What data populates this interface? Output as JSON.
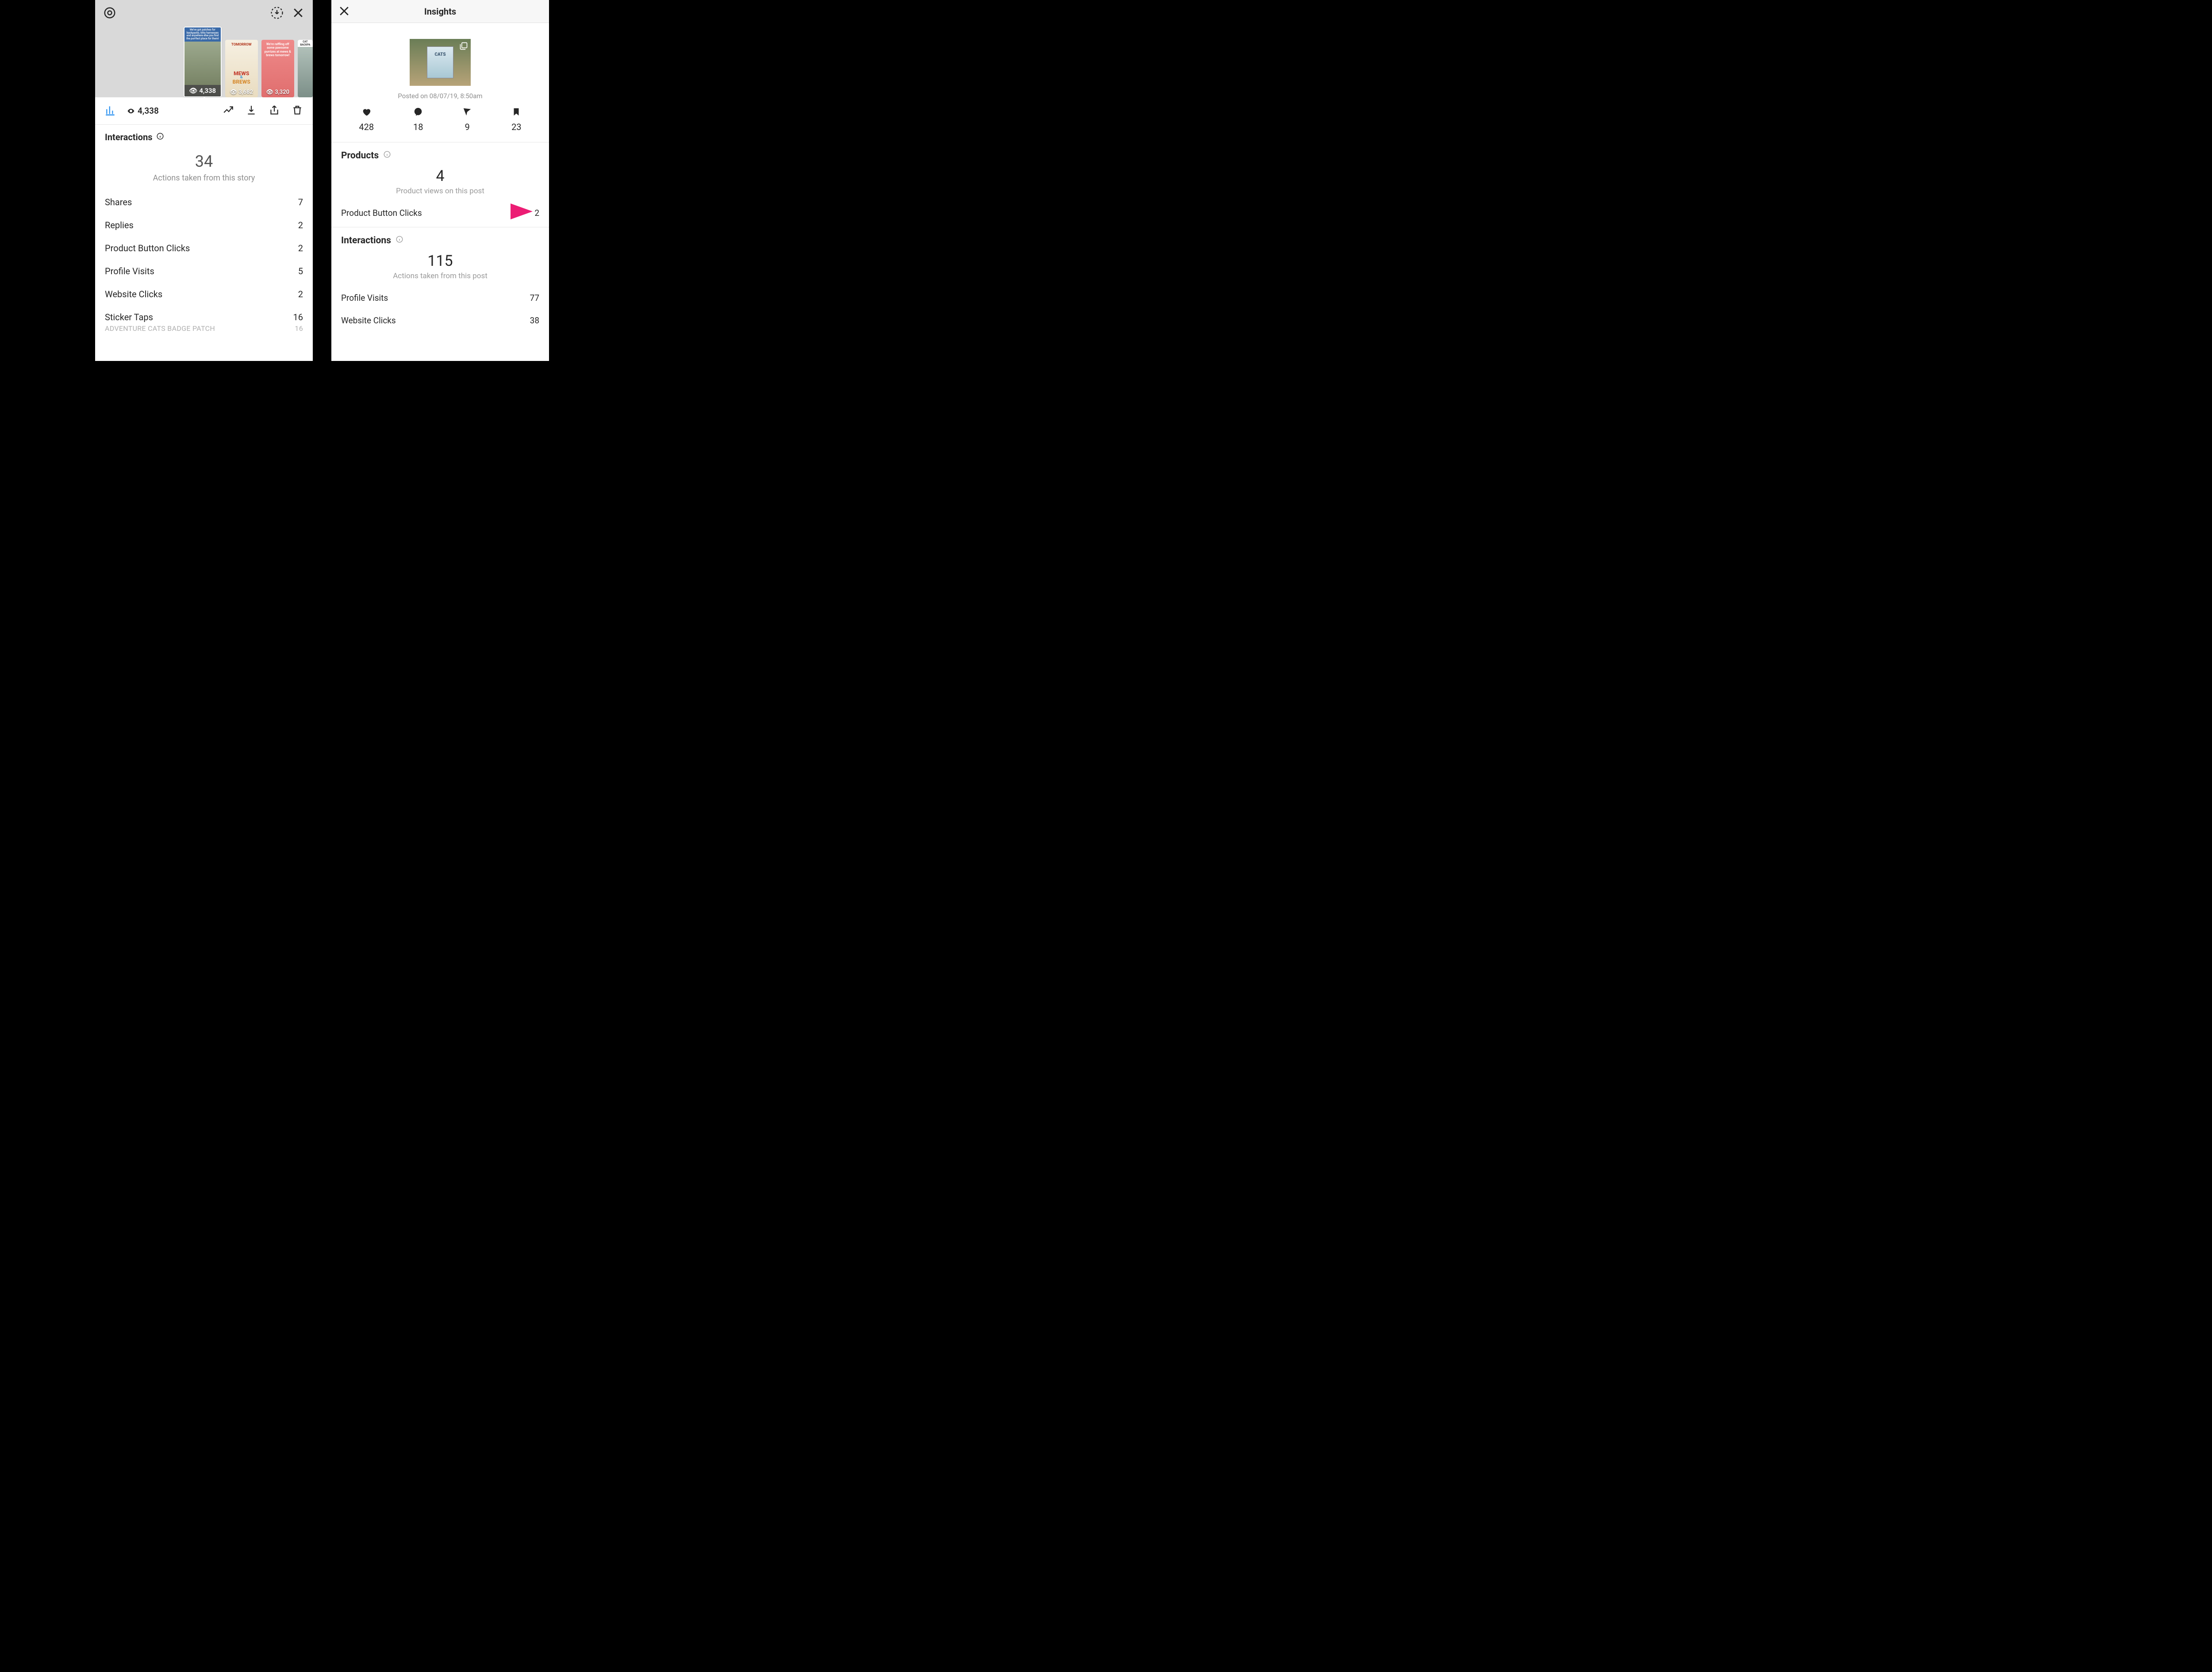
{
  "left": {
    "stories": [
      {
        "banner": "We've got patches for backpacks, kitty harnesses and anywhere else you find the purrfect place for them!",
        "views": "4,338"
      },
      {
        "top": "TOMORROW",
        "line1": "MEWS",
        "amp": "&",
        "line2": "BREWS",
        "views": "3,682"
      },
      {
        "msg": "We're raffling off some pawsome purrizes at mews & brews tomorrow!",
        "views": "3,320"
      },
      {
        "top": "CAT BACKPA",
        "bottom": "Instructio"
      }
    ],
    "toolbar_views": "4,338",
    "interactions": {
      "title": "Interactions",
      "total": "34",
      "subtitle": "Actions taken from this story",
      "rows": [
        {
          "label": "Shares",
          "value": "7"
        },
        {
          "label": "Replies",
          "value": "2"
        },
        {
          "label": "Product Button Clicks",
          "value": "2"
        },
        {
          "label": "Profile Visits",
          "value": "5"
        },
        {
          "label": "Website Clicks",
          "value": "2"
        },
        {
          "label": "Sticker Taps",
          "value": "16"
        }
      ],
      "sticker_sub_label": "ADVENTURE CATS BADGE PATCH",
      "sticker_sub_value": "16"
    }
  },
  "right": {
    "header": "Insights",
    "posted": "Posted on 08/07/19, 8:50am",
    "engagement": {
      "likes": "428",
      "comments": "18",
      "shares": "9",
      "saves": "23"
    },
    "products": {
      "title": "Products",
      "total": "4",
      "subtitle": "Product views on this post",
      "row_label": "Product Button Clicks",
      "row_value": "2"
    },
    "interactions": {
      "title": "Interactions",
      "total": "115",
      "subtitle": "Actions taken from this post",
      "rows": [
        {
          "label": "Profile Visits",
          "value": "77"
        },
        {
          "label": "Website Clicks",
          "value": "38"
        }
      ]
    }
  },
  "colors": {
    "arrow": "#ec1d74"
  }
}
